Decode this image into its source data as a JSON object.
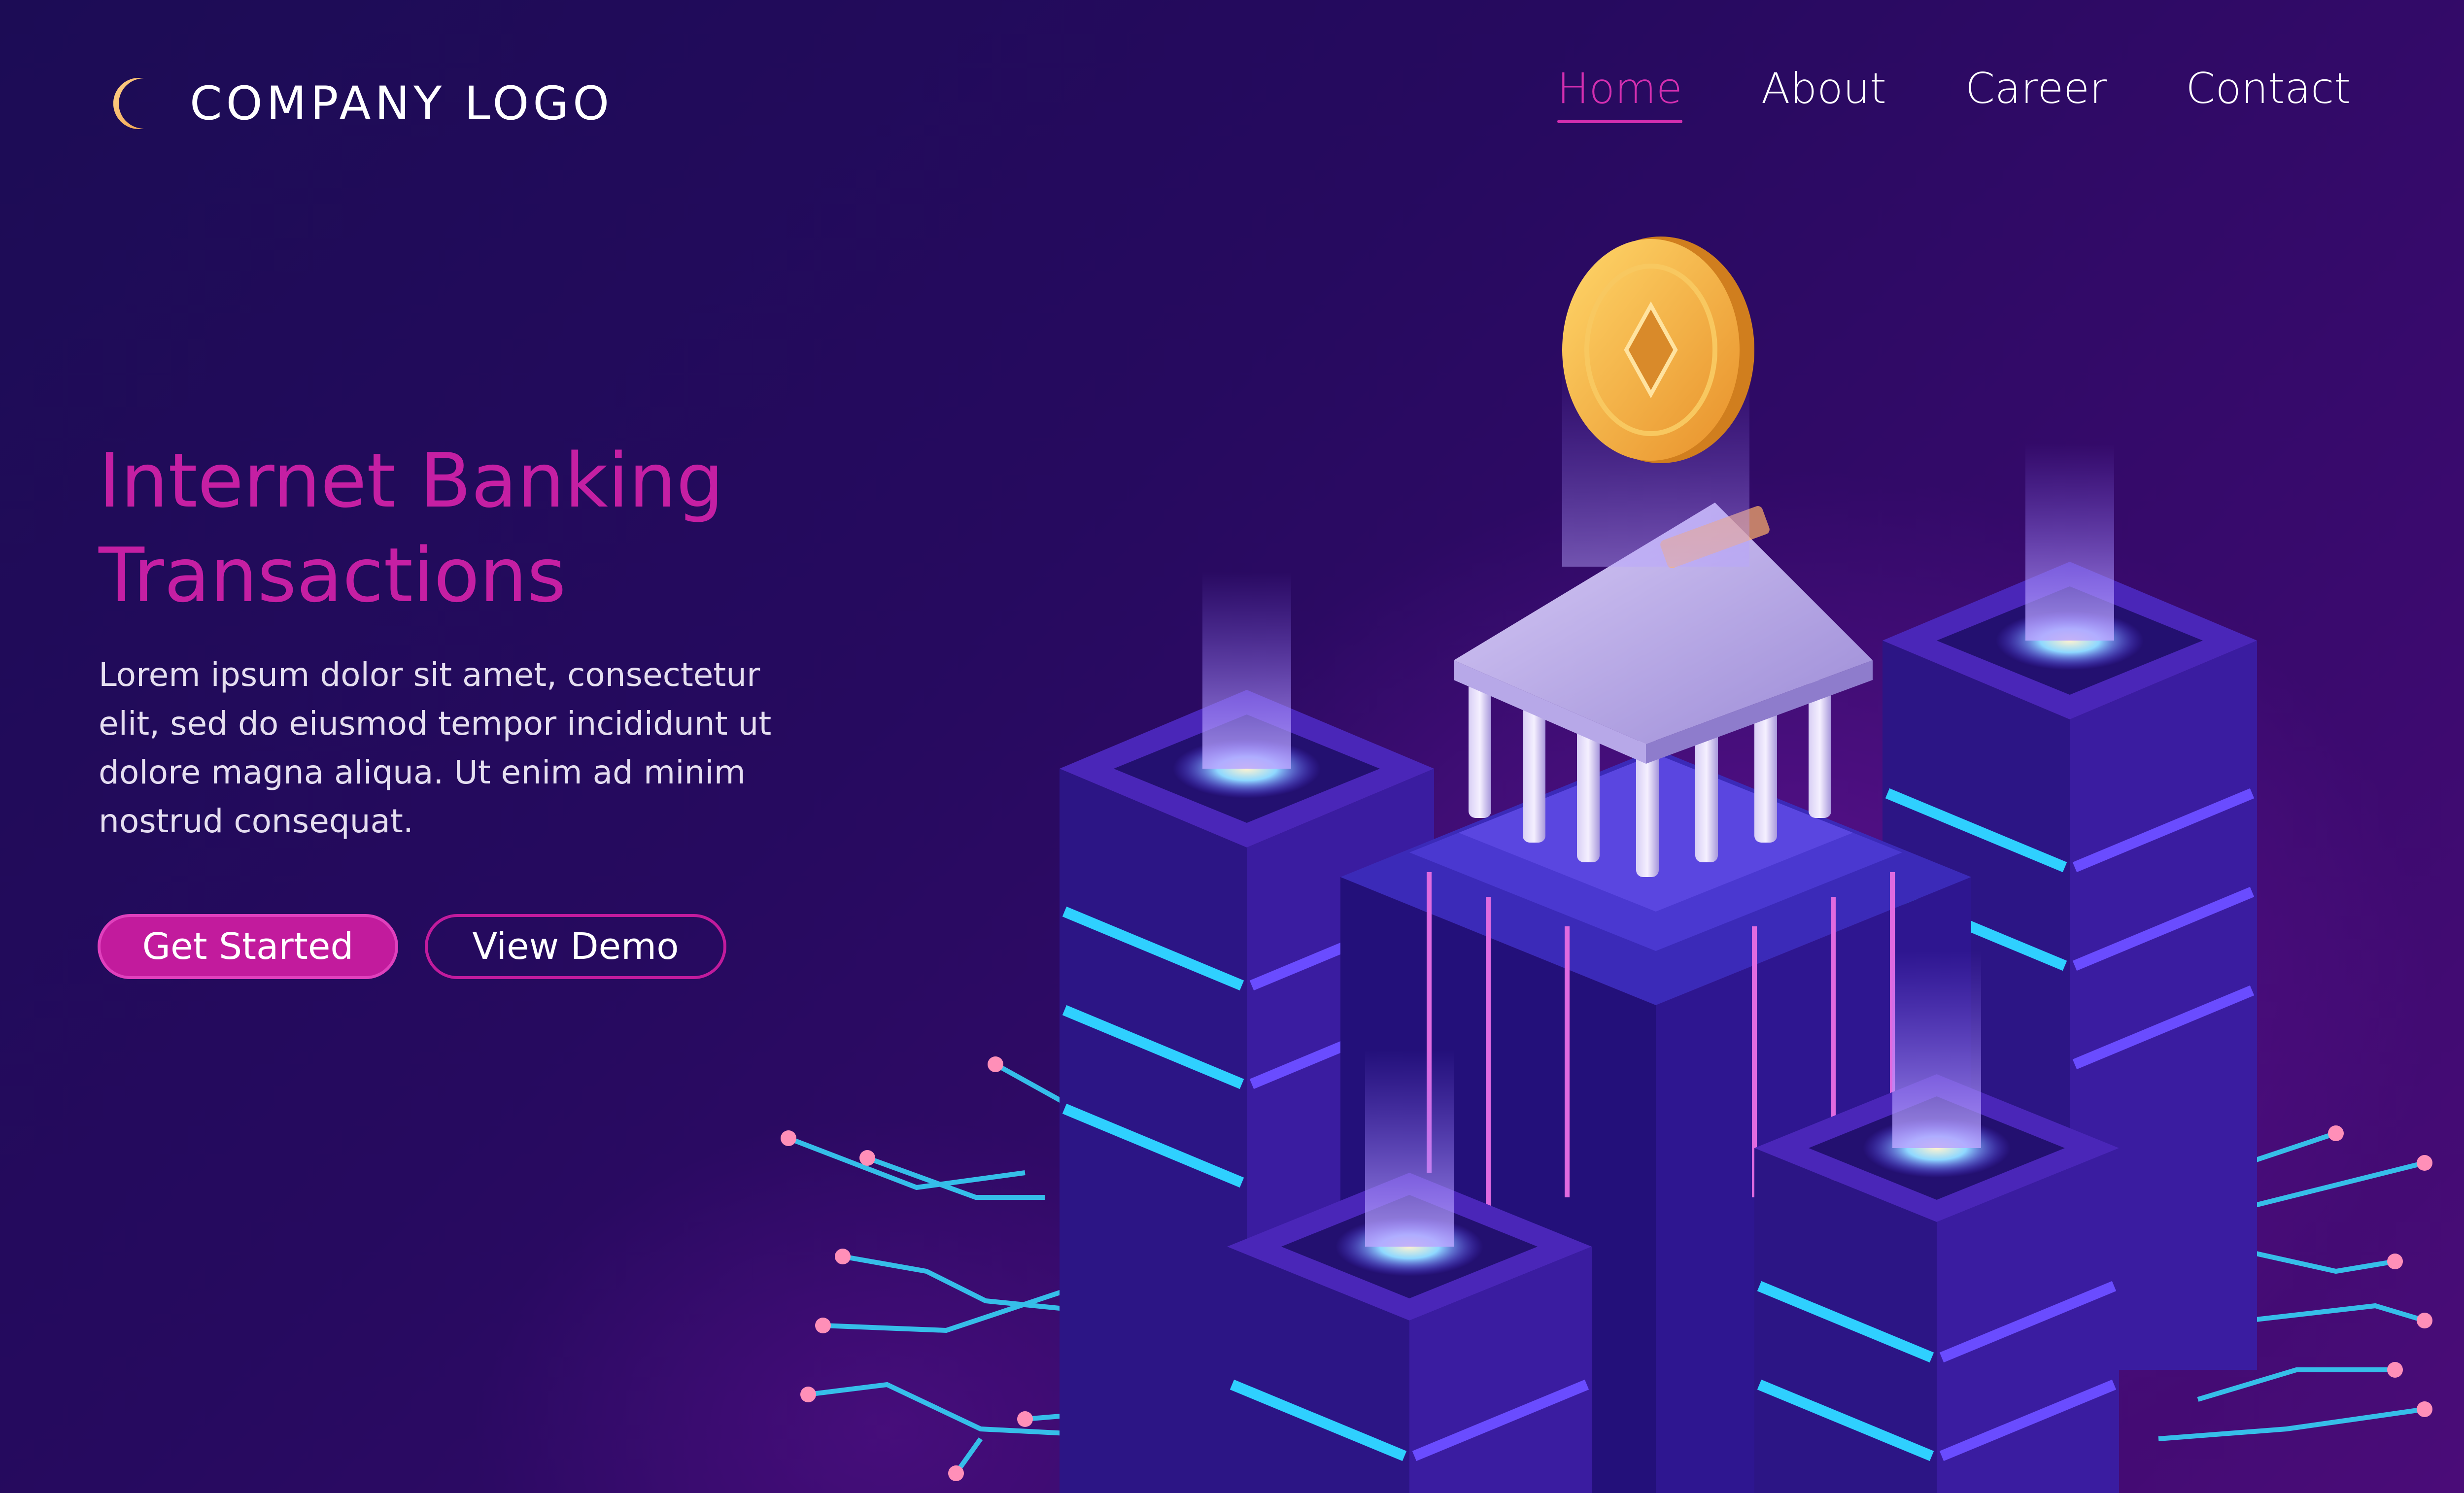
{
  "header": {
    "logo_text": "COMPANY LOGO",
    "logo_icon": "crescent-moon-icon",
    "nav": [
      {
        "label": "Home",
        "active": true
      },
      {
        "label": "About",
        "active": false
      },
      {
        "label": "Career",
        "active": false
      },
      {
        "label": "Contact",
        "active": false
      }
    ]
  },
  "hero": {
    "title": "Internet Banking\nTransactions",
    "body": "Lorem ipsum dolor sit amet, consectetur elit, sed do eiusmod tempor incididunt ut dolore magna aliqua. Ut enim ad minim nostrud consequat.",
    "primary_button": "Get Started",
    "secondary_button": "View Demo"
  },
  "illustration": {
    "description_icon": "bank-server-isometric-icon",
    "coin_icon": "gold-coin-icon"
  },
  "colors": {
    "accent": "#c51fa3",
    "background_dark": "#1c0c55",
    "background_purple": "#4a0c78",
    "cyan": "#27c8f0",
    "gold": "#f5b23a"
  }
}
